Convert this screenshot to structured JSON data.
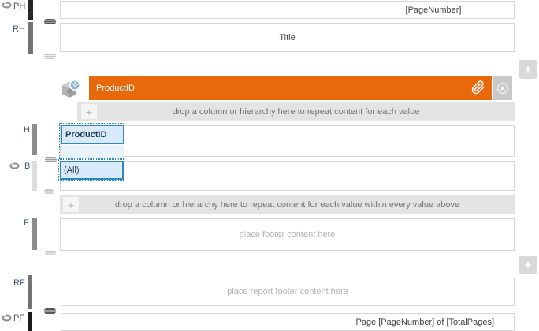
{
  "colors": {
    "accent_orange": "#e8690b",
    "selection_blue": "#2e88c8",
    "selection_fill": "#d9ebfa",
    "dropzone_bg": "#e3e3e3",
    "dropzone_text": "#737373",
    "placeholder_text": "#b3b3b3"
  },
  "rail": {
    "ph_label": "PH",
    "rh_label": "RH",
    "h_label": "H",
    "b_label": "B",
    "f_label": "F",
    "rf_label": "RF",
    "pf_label": "PF"
  },
  "page_header": {
    "content": "[PageNumber]"
  },
  "report_header": {
    "content": "Title"
  },
  "group": {
    "title": "ProductID",
    "drop_zone_top": "drop a column or hierarchy here to repeat content for each value",
    "header_cell": "ProductID",
    "body_cell": "(All)",
    "drop_zone_bottom": "drop a column or hierarchy here to repeat content for each value within every value above",
    "footer_placeholder": "place footer content here"
  },
  "report_footer": {
    "placeholder": "place report footer content here"
  },
  "page_footer": {
    "content": "Page [PageNumber] of [TotalPages]"
  },
  "buttons": {
    "plus": "+"
  }
}
